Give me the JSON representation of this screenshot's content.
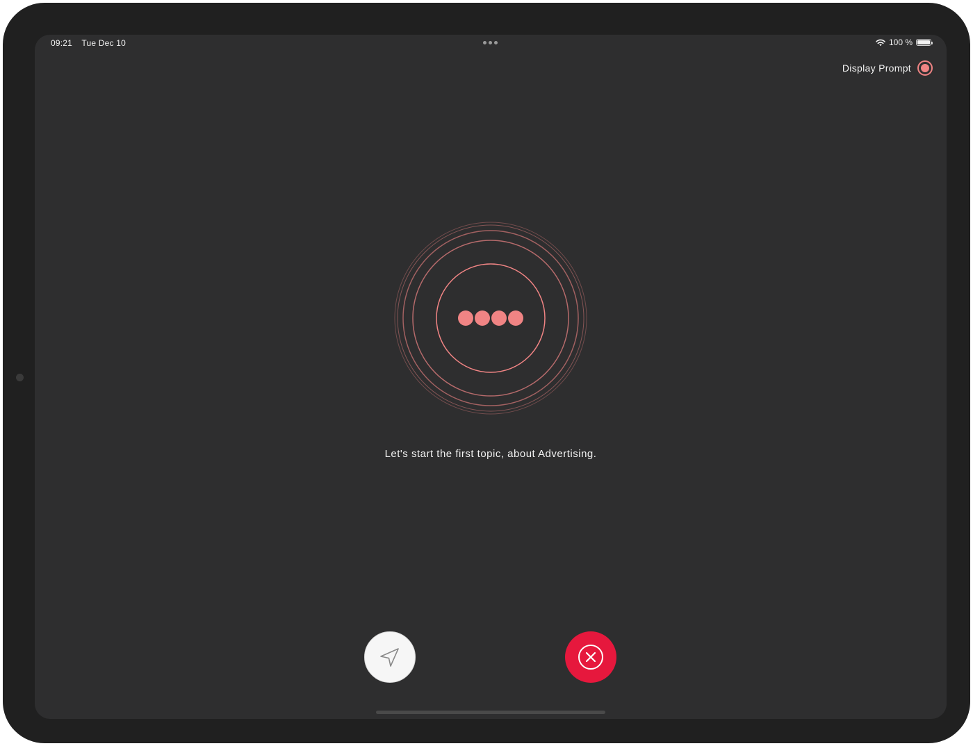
{
  "status_bar": {
    "time": "09:21",
    "date": "Tue Dec 10",
    "battery": "100 %",
    "wifi_icon": "wifi-icon",
    "battery_icon": "battery-icon",
    "multitask_icon": "more-dots-icon"
  },
  "header": {
    "display_prompt_label": "Display Prompt",
    "display_prompt_on": true
  },
  "main": {
    "message": "Let's start the first topic, about Advertising.",
    "indicator_icon": "typing-dots-icon"
  },
  "actions": {
    "send_icon": "send-icon",
    "cancel_icon": "close-circle-icon"
  },
  "colors": {
    "accent": "#f08484",
    "cancel": "#e6183d",
    "screen_background": "#2e2e2f"
  }
}
